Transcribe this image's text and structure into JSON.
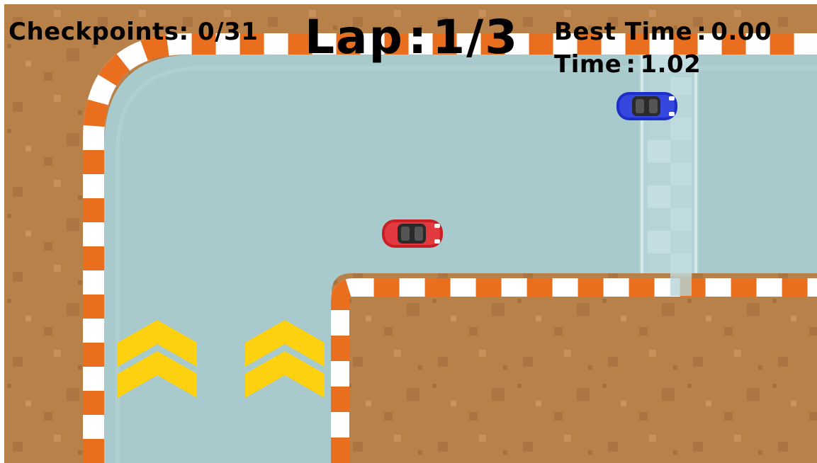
{
  "hud": {
    "checkpoints_label": "Checkpoints:",
    "checkpoints_value": "0/31",
    "lap_label": "Lap",
    "lap_value": "1/3",
    "best_time_label": "Best Time",
    "best_time_value": "0.00",
    "time_label": "Time",
    "time_value": "1.02",
    "separator": ":"
  },
  "colors": {
    "dirt": "#b9814a",
    "dirt_speckle_dark": "#9e6a3a",
    "dirt_speckle_light": "#c99562",
    "track": "#a8cacc",
    "track_edge": "#98bcc0",
    "curb_orange": "#e96e1e",
    "curb_white": "#ffffff",
    "arrow_yellow": "#fdd10f",
    "finish_line": "#c3dde0",
    "player_car": "#c81e24",
    "opponent_car": "#1e2fc8"
  },
  "icons": {
    "player": "red-race-car-icon",
    "opponent": "blue-race-car-icon",
    "direction": "chevron-up-arrow-icon"
  }
}
